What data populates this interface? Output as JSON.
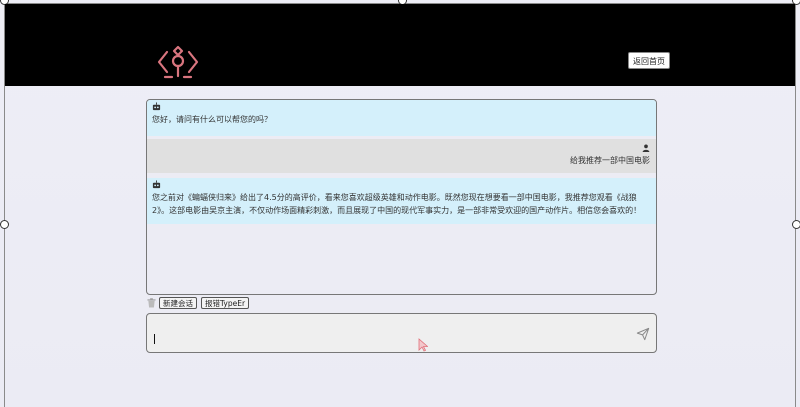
{
  "header": {
    "home_button": "返回首页"
  },
  "messages": [
    {
      "role": "bot",
      "text": "您好，请问有什么可以帮您的吗？"
    },
    {
      "role": "user",
      "text": "给我推荐一部中国电影"
    },
    {
      "role": "bot",
      "text": "您之前对《蝙蝠侠归来》给出了4.5分的高评价，看来您喜欢超级英雄和动作电影。既然您现在想要看一部中国电影，我推荐您观看《战狼2》。这部电影由吴京主演，不仅动作场面精彩刺激，而且展现了中国的现代军事实力，是一部非常受欢迎的国产动作片。相信您会喜欢的！"
    }
  ],
  "toolbar": {
    "new_chat": "新建会话",
    "report_typeer": "报错TypeEr"
  },
  "input": {
    "value": ""
  },
  "colors": {
    "header_bg": "#000000",
    "logo": "#d9757f",
    "bot_bg": "#d4f0fb",
    "user_bg": "#e0e0e0",
    "cursor": "#e0707a"
  }
}
